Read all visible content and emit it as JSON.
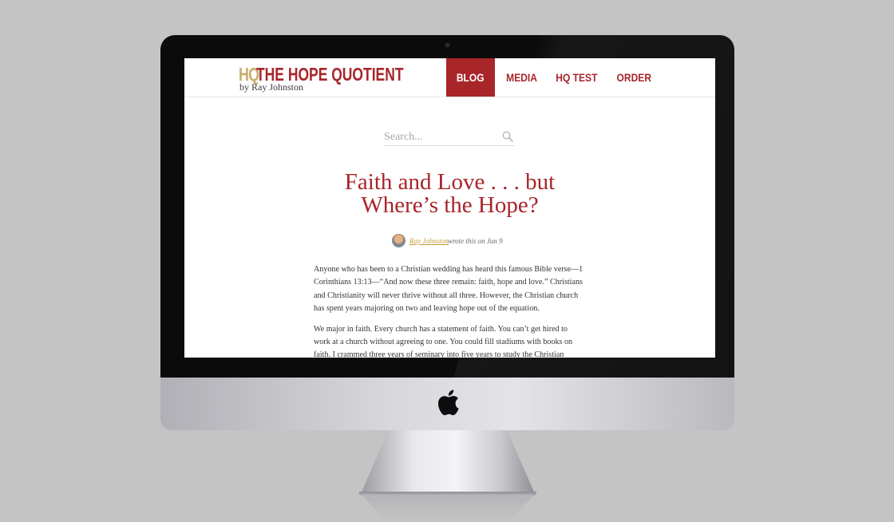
{
  "site": {
    "logo_hq": "HQ",
    "logo_name": "THE HOPE QUOTIENT",
    "logo_by": "by Ray Johnston"
  },
  "nav": {
    "items": [
      {
        "label": "BLOG",
        "active": true
      },
      {
        "label": "MEDIA",
        "active": false
      },
      {
        "label": "HQ TEST",
        "active": false
      },
      {
        "label": "ORDER",
        "active": false
      }
    ]
  },
  "search": {
    "placeholder": "Search..."
  },
  "post": {
    "title_line1": "Faith and Love . . . but",
    "title_line2": "Where’s the Hope?",
    "author": "Ray Johnston",
    "meta": "wrote this on Jun 9",
    "paragraphs": [
      "Anyone who has been to a Christian wedding has heard this famous Bible verse—1 Corinthians 13:13—“And now these three remain: faith, hope and love.” Christians and Christianity will never thrive without all three. However, the Christian church has spent years majoring on two and leaving hope out of the equation.",
      "We major in faith. Every church has a statement of faith. You can’t get hired to work at a church without agreeing to one. You could fill stadiums with books on faith. I crammed three years of seminary into five years to study the Christian"
    ]
  },
  "colors": {
    "brand_red": "#a8252a",
    "brand_gold": "#c9ad6a",
    "link_gold": "#c69a3a"
  },
  "icons": {
    "search": "search-icon",
    "device_logo": "apple-logo-icon",
    "avatar": "avatar"
  }
}
